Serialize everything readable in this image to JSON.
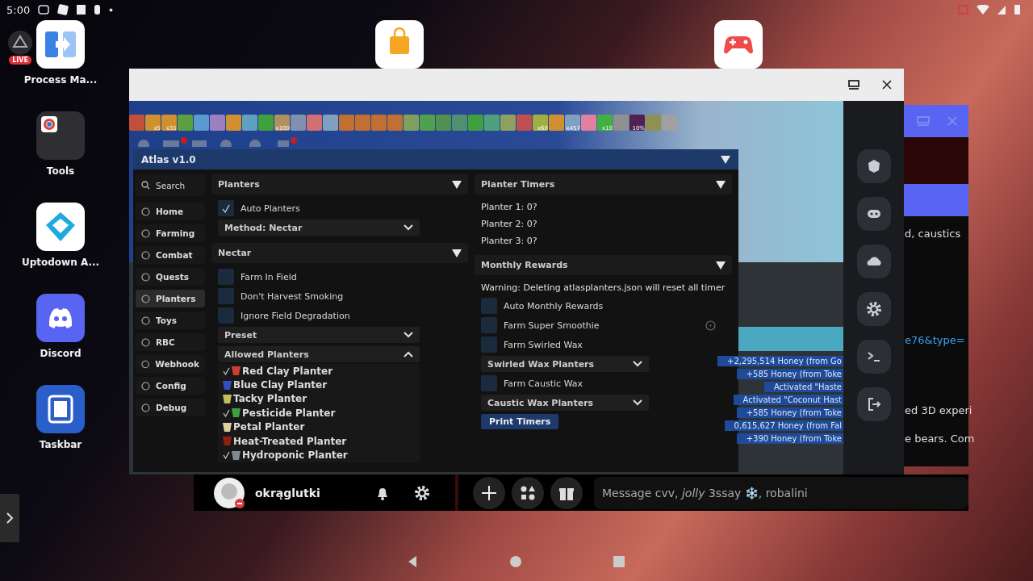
{
  "status_bar": {
    "time": "5:00"
  },
  "live_badge": "LIVE",
  "desktop_icons": [
    {
      "kind": "process",
      "label": "Process Ma..."
    },
    {
      "kind": "folder",
      "label": "Tools"
    },
    {
      "kind": "uptodown",
      "label": "Uptodown A..."
    },
    {
      "kind": "discord",
      "label": "Discord"
    },
    {
      "kind": "taskbar",
      "label": "Taskbar"
    }
  ],
  "game": {
    "buffs": [
      {
        "color": "#c0503a"
      },
      {
        "color": "#d09030",
        "count": "x5"
      },
      {
        "color": "#d09030",
        "count": "x31"
      },
      {
        "color": "#5aa040"
      },
      {
        "color": "#5a9ad0"
      },
      {
        "color": "#9a80c0"
      },
      {
        "color": "#d09030"
      },
      {
        "color": "#60a0c0"
      },
      {
        "color": "#40a040"
      },
      {
        "color": "#b09060",
        "count": "x100"
      },
      {
        "color": "#8090b0"
      },
      {
        "color": "#d07070"
      },
      {
        "color": "#80a0c0"
      },
      {
        "color": "#c07030"
      },
      {
        "color": "#c07030"
      },
      {
        "color": "#c07030"
      },
      {
        "color": "#c07030"
      },
      {
        "color": "#80a060"
      },
      {
        "color": "#50a050"
      },
      {
        "color": "#509050"
      },
      {
        "color": "#509070"
      },
      {
        "color": "#40a040"
      },
      {
        "color": "#50a080"
      },
      {
        "color": "#90a060"
      },
      {
        "color": "#c05050"
      },
      {
        "color": "#a0b040",
        "count": "x60"
      },
      {
        "color": "#d09030"
      },
      {
        "color": "#80a0c0",
        "count": "x457"
      },
      {
        "color": "#e080a0"
      },
      {
        "color": "#40b040",
        "count": "x10"
      },
      {
        "color": "#909090"
      },
      {
        "color": "#502050",
        "count": "10%"
      },
      {
        "color": "#909050"
      },
      {
        "color": "#a0a0a0"
      }
    ],
    "notifications": [
      "+2,295,514 Honey (from Go",
      "+585 Honey (from Toke",
      "Activated \"Haste",
      "Activated \"Coconut Hast",
      "+585 Honey (from Toke",
      "0,615,627 Honey (from Fal",
      "+390 Honey (from Toke"
    ]
  },
  "atlas": {
    "title": "Atlas v1.0",
    "search": "Search",
    "nav": [
      {
        "label": "Home",
        "selected": false
      },
      {
        "label": "Farming",
        "selected": false
      },
      {
        "label": "Combat",
        "selected": false
      },
      {
        "label": "Quests",
        "selected": false
      },
      {
        "label": "Planters",
        "selected": true
      },
      {
        "label": "Toys",
        "selected": false
      },
      {
        "label": "RBC",
        "selected": false
      },
      {
        "label": "Webhook",
        "selected": false
      },
      {
        "label": "Config",
        "selected": false
      },
      {
        "label": "Debug",
        "selected": false
      }
    ],
    "left_sections": [
      {
        "title": "Planters",
        "items": [
          {
            "kind": "checkbox",
            "label": "Auto Planters",
            "checked": true
          },
          {
            "kind": "dropdown",
            "label": "Method: Nectar",
            "expanded": false
          }
        ]
      },
      {
        "title": "Nectar",
        "items": [
          {
            "kind": "checkbox",
            "label": "Farm In Field",
            "checked": false
          },
          {
            "kind": "checkbox",
            "label": "Don't Harvest Smoking",
            "checked": false
          },
          {
            "kind": "checkbox",
            "label": "Ignore Field Degradation",
            "checked": false
          },
          {
            "kind": "dropdown",
            "label": "Preset",
            "expanded": false
          },
          {
            "kind": "dropdown",
            "label": "Allowed Planters",
            "expanded": true,
            "options": [
              {
                "label": "Red Clay Planter",
                "checked": true,
                "color": "#c84030"
              },
              {
                "label": "Blue Clay Planter",
                "checked": false,
                "color": "#3050c0"
              },
              {
                "label": "Tacky Planter",
                "checked": false,
                "color": "#c0c060"
              },
              {
                "label": "Pesticide Planter",
                "checked": true,
                "color": "#40a040"
              },
              {
                "label": "Petal Planter",
                "checked": false,
                "color": "#e0d0a0"
              },
              {
                "label": "Heat-Treated Planter",
                "checked": false,
                "color": "#902010"
              },
              {
                "label": "Hydroponic Planter",
                "checked": true,
                "color": "#808890"
              }
            ]
          }
        ]
      }
    ],
    "right_sections": [
      {
        "title": "Planter Timers",
        "items": [
          {
            "kind": "text",
            "label": "Planter 1: 0?"
          },
          {
            "kind": "text",
            "label": "Planter 2: 0?"
          },
          {
            "kind": "text",
            "label": "Planter 3: 0?"
          }
        ]
      },
      {
        "title": "Monthly Rewards",
        "items": [
          {
            "kind": "text",
            "label": "Warning: Deleting atlasplanters.json will reset all timer"
          },
          {
            "kind": "checkbox",
            "label": "Auto Monthly Rewards",
            "checked": false
          },
          {
            "kind": "checkbox",
            "label": "Farm Super Smoothie",
            "checked": false,
            "info": true
          },
          {
            "kind": "checkbox",
            "label": "Farm Swirled Wax",
            "checked": false
          },
          {
            "kind": "dropdown",
            "label": "Swirled Wax Planters",
            "expanded": false
          },
          {
            "kind": "checkbox",
            "label": "Farm Caustic Wax",
            "checked": false
          },
          {
            "kind": "dropdown",
            "label": "Caustic Wax Planters",
            "expanded": false
          },
          {
            "kind": "button",
            "label": "Print Timers"
          }
        ]
      }
    ]
  },
  "discord_window": {
    "lines": [
      "d, caustics",
      "e76&type=",
      "ed 3D experi",
      "e bears. Com"
    ]
  },
  "discord_bar": {
    "username": "okrąglutki",
    "message_placeholder": "Message cvv, *jolly* 3ssay ❄️, robalini"
  }
}
